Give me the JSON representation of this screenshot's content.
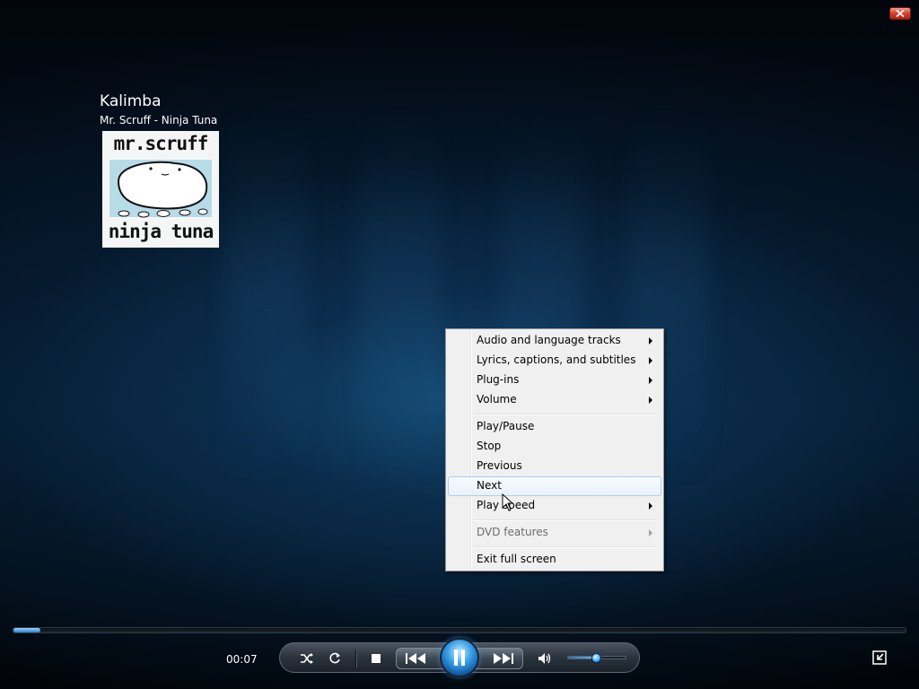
{
  "now_playing": {
    "title": "Kalimba",
    "subtitle": "Mr. Scruff - Ninja Tuna",
    "album_art_text_top": "mr.scruff",
    "album_art_text_bottom": "ninja tuna"
  },
  "context_menu": {
    "items": [
      {
        "label": "Audio and language tracks",
        "submenu": true
      },
      {
        "label": "Lyrics, captions, and subtitles",
        "submenu": true
      },
      {
        "label": "Plug-ins",
        "submenu": true
      },
      {
        "label": "Volume",
        "submenu": true
      },
      {
        "label": "Play/Pause",
        "submenu": false
      },
      {
        "label": "Stop",
        "submenu": false
      },
      {
        "label": "Previous",
        "submenu": false
      },
      {
        "label": "Next",
        "submenu": false,
        "highlighted": true
      },
      {
        "label": "Play speed",
        "submenu": true
      },
      {
        "label": "DVD features",
        "submenu": true,
        "disabled": true
      },
      {
        "label": "Exit full screen",
        "submenu": false
      }
    ]
  },
  "playback": {
    "elapsed": "00:07",
    "progress_fraction": 0.03,
    "volume_fraction": 0.5
  },
  "controls": {
    "shuffle_icon": "shuffle-icon",
    "repeat_icon": "repeat-icon",
    "stop_icon": "stop-icon",
    "previous_icon": "previous-icon",
    "play_pause_icon": "pause-icon",
    "next_icon": "next-icon",
    "mute_icon": "speaker-icon",
    "library_icon": "switch-to-library-icon",
    "close_icon": "close-icon"
  },
  "colors": {
    "accent": "#3aa0e8",
    "menu_bg": "#f0f0f0",
    "close_red": "#d8402a"
  }
}
